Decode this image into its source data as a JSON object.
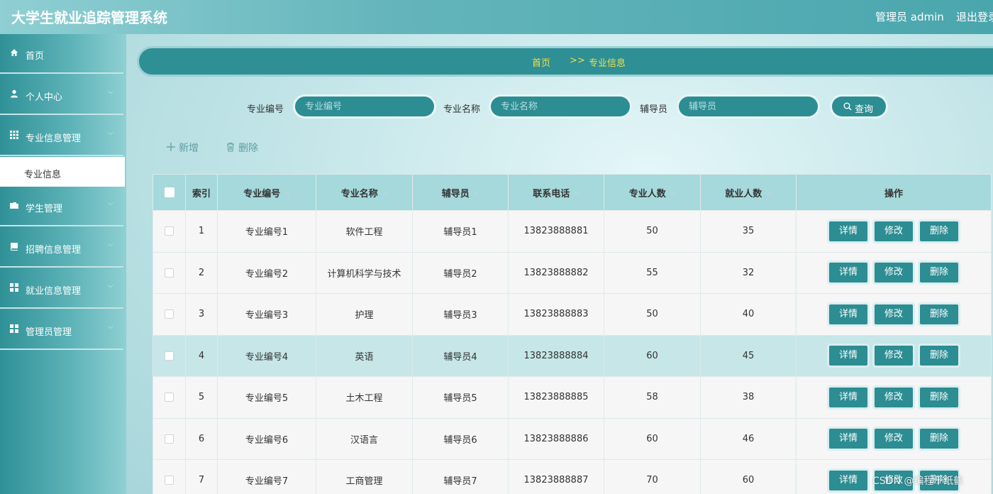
{
  "header": {
    "title": "大学生就业追踪管理系统",
    "user": "管理员 admin",
    "logout": "退出登录"
  },
  "sidebar": {
    "items": [
      {
        "label": "首页",
        "icon": "home-icon",
        "chevron": ""
      },
      {
        "label": "个人中心",
        "icon": "user-icon",
        "chevron": "⌵"
      },
      {
        "label": "专业信息管理",
        "icon": "grid-icon",
        "chevron": "⌵"
      },
      {
        "label": "学生管理",
        "icon": "folder-icon",
        "chevron": "⌵"
      },
      {
        "label": "招聘信息管理",
        "icon": "book-icon",
        "chevron": "⌵"
      },
      {
        "label": "就业信息管理",
        "icon": "apps-icon",
        "chevron": "⌵"
      },
      {
        "label": "管理员管理",
        "icon": "apps-icon",
        "chevron": "⌵"
      }
    ],
    "active_sub": "专业信息"
  },
  "breadcrumb": {
    "home": "首页",
    "sep": ">>",
    "current": "专业信息"
  },
  "search": {
    "major_code_label": "专业编号",
    "major_code_placeholder": "专业编号",
    "major_name_label": "专业名称",
    "major_name_placeholder": "专业名称",
    "counselor_label": "辅导员",
    "counselor_placeholder": "辅导员",
    "button": "查询"
  },
  "actions": {
    "add": "新增",
    "delete": "删除"
  },
  "table": {
    "columns": [
      "索引",
      "专业编号",
      "专业名称",
      "辅导员",
      "联系电话",
      "专业人数",
      "就业人数",
      "操作"
    ],
    "row_buttons": {
      "detail": "详情",
      "edit": "修改",
      "delete": "删除"
    },
    "rows": [
      [
        "1",
        "专业编号1",
        "软件工程",
        "辅导员1",
        "13823888881",
        "50",
        "35"
      ],
      [
        "2",
        "专业编号2",
        "计算机科学与技术",
        "辅导员2",
        "13823888882",
        "55",
        "32"
      ],
      [
        "3",
        "专业编号3",
        "护理",
        "辅导员3",
        "13823888883",
        "50",
        "40"
      ],
      [
        "4",
        "专业编号4",
        "英语",
        "辅导员4",
        "13823888884",
        "60",
        "45"
      ],
      [
        "5",
        "专业编号5",
        "土木工程",
        "辅导员5",
        "13823888885",
        "58",
        "38"
      ],
      [
        "6",
        "专业编号6",
        "汉语言",
        "辅导员6",
        "13823888886",
        "60",
        "46"
      ],
      [
        "7",
        "专业编号7",
        "工商管理",
        "辅导员7",
        "13823888887",
        "70",
        "60"
      ]
    ],
    "highlighted_row": 4
  },
  "watermark": "CSDN @编程千纸鹤",
  "colors": {
    "primary": "#2c8d93",
    "header_bg": "#a6d9dc",
    "breadcrumb_text": "#f3e04a"
  }
}
